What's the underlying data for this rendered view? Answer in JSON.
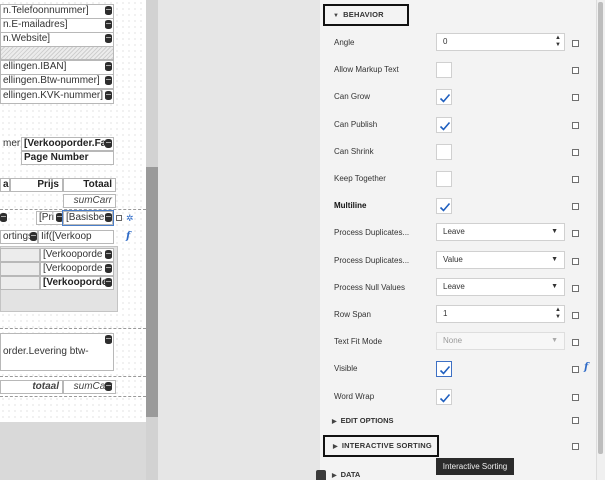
{
  "designer": {
    "fields": [
      "n.Telefoonnummer]",
      "n.E-mailadres]",
      "n.Website]",
      "ellingen.IBAN]",
      "ellingen.Btw-nummer]",
      "ellingen.KVK-nummer]"
    ],
    "summary": {
      "label_left": "mer",
      "order_field": "[Verkooporder.Fa",
      "page_number": "Page Number"
    },
    "table_header": {
      "col_a": "al",
      "col_b": "Prijs",
      "col_c": "Totaal"
    },
    "sum_carry_1": "sumCarr",
    "row_price": "[Pri",
    "row_basis": "[Basisbe",
    "sortings": "ortings",
    "iif": "Iif([Verkoop",
    "verkoop_1": "[Verkooporde",
    "verkoop_2": "[Verkooporde",
    "verkoop_3": "[Verkooporde",
    "levering": "order.Levering btw-",
    "totaal": "totaal",
    "sum_carry_2": "sumCarr"
  },
  "properties": {
    "behavior_header": "BEHAVIOR",
    "rows": [
      {
        "label": "Angle",
        "type": "spin",
        "value": "0"
      },
      {
        "label": "Allow Markup Text",
        "type": "check",
        "checked": false
      },
      {
        "label": "Can Grow",
        "type": "check",
        "checked": true
      },
      {
        "label": "Can Publish",
        "type": "check",
        "checked": true
      },
      {
        "label": "Can Shrink",
        "type": "check",
        "checked": false
      },
      {
        "label": "Keep Together",
        "type": "check",
        "checked": false
      },
      {
        "label": "Multiline",
        "type": "check",
        "checked": true,
        "bold": true
      },
      {
        "label": "Process Duplicates...",
        "type": "select",
        "value": "Leave"
      },
      {
        "label": "Process Duplicates...",
        "type": "select",
        "value": "Value"
      },
      {
        "label": "Process Null Values",
        "type": "select",
        "value": "Leave"
      },
      {
        "label": "Row Span",
        "type": "spin",
        "value": "1"
      },
      {
        "label": "Text Fit Mode",
        "type": "select",
        "value": "None",
        "disabled": true
      },
      {
        "label": "Visible",
        "type": "check",
        "checked": true,
        "focused": true,
        "has_expression": true
      },
      {
        "label": "Word Wrap",
        "type": "check",
        "checked": true
      }
    ],
    "edit_options": "EDIT OPTIONS",
    "interactive_sorting": "INTERACTIVE SORTING",
    "data": "DATA",
    "tooltip": "Interactive Sorting",
    "expression_glyph": "f"
  },
  "colors": {
    "accent": "#2d6ac7",
    "check": "#1f5fbf",
    "panel_bg": "#f3f3f3"
  }
}
